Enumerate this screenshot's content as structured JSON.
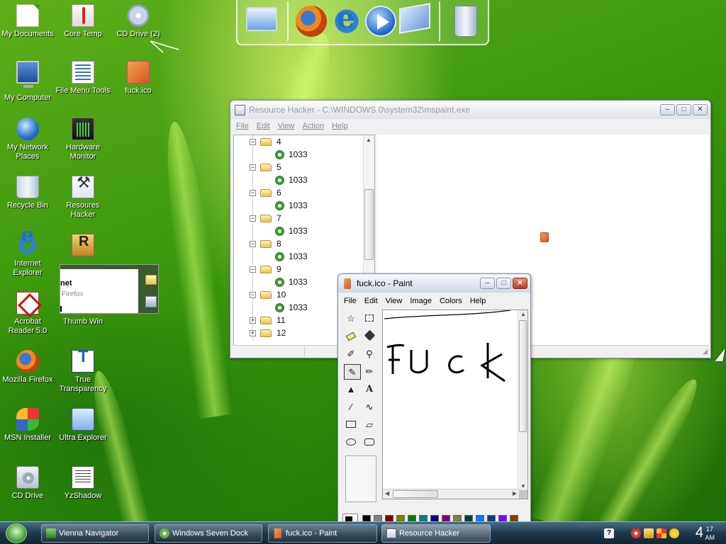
{
  "desktop": {
    "icons": {
      "my_documents": "My Documents",
      "core_temp": "Core Temp",
      "cd_drive_2": "CD Drive (2)",
      "my_computer": "My Computer",
      "file_menu_tools": "File Menu Tools",
      "fuck_ico": "fuck.ico",
      "my_network_places_1": "My Network",
      "my_network_places_2": "Places",
      "hardware_monitor_1": "Hardware",
      "hardware_monitor_2": "Monitor",
      "recycle_bin": "Recycle Bin",
      "resoures_hacker_1": "Resoures",
      "resoures_hacker_2": "Hacker",
      "internet_explorer_1": "Internet",
      "internet_explorer_2": "Explorer",
      "acrobat_1": "Acrobat",
      "acrobat_2": "Reader 5.0",
      "thumb_win": "Thumb Win",
      "mozilla_firefox": "Mozilla Firefox",
      "true_transparency_1": "True",
      "true_transparency_2": "Transparency",
      "msn_installer": "MSN Installer",
      "ultra_explorer": "Ultra Explorer",
      "cd_drive": "CD Drive",
      "yzshadow": "YzShadow"
    },
    "overlay": {
      "line1": "net",
      "line2": "Firefox"
    }
  },
  "dock": {
    "items": [
      "monitor-icon",
      "firefox-icon",
      "internet-explorer-icon",
      "media-player-icon",
      "windows-icon",
      "recycle-bin-icon"
    ]
  },
  "resource_hacker": {
    "title": "Resource Hacker   -  C:\\WINDOWS 0\\system32\\mspaint.exe",
    "menu": [
      "File",
      "Edit",
      "View",
      "Action",
      "Help"
    ],
    "tree": [
      {
        "label": "4",
        "type": "folder",
        "expanded": true
      },
      {
        "label": "1033",
        "type": "resource"
      },
      {
        "label": "5",
        "type": "folder",
        "expanded": true
      },
      {
        "label": "1033",
        "type": "resource"
      },
      {
        "label": "6",
        "type": "folder",
        "expanded": true
      },
      {
        "label": "1033",
        "type": "resource"
      },
      {
        "label": "7",
        "type": "folder",
        "expanded": true
      },
      {
        "label": "1033",
        "type": "resource"
      },
      {
        "label": "8",
        "type": "folder",
        "expanded": true
      },
      {
        "label": "1033",
        "type": "resource"
      },
      {
        "label": "9",
        "type": "folder",
        "expanded": true
      },
      {
        "label": "1033",
        "type": "resource"
      },
      {
        "label": "10",
        "type": "folder",
        "expanded": true
      },
      {
        "label": "1033",
        "type": "resource"
      },
      {
        "label": "11",
        "type": "folder",
        "expanded": false
      },
      {
        "label": "12",
        "type": "folder",
        "expanded": false
      }
    ]
  },
  "paint": {
    "title": "fuck.ico - Paint",
    "menu": [
      "File",
      "Edit",
      "View",
      "Image",
      "Colors",
      "Help"
    ],
    "tools": [
      "free-select",
      "rect-select",
      "eraser",
      "fill",
      "color-picker",
      "magnifier",
      "pencil",
      "brush",
      "airbrush",
      "text",
      "line",
      "curve",
      "rectangle",
      "polygon",
      "ellipse",
      "rounded-rectangle"
    ],
    "palette": [
      "#000000",
      "#808080",
      "#800000",
      "#808000",
      "#008000",
      "#008080",
      "#000080",
      "#800080",
      "#808040",
      "#004040",
      "#0080ff",
      "#004080",
      "#8000ff",
      "#804000"
    ]
  },
  "taskbar": {
    "tasks": [
      {
        "label": "Vienna Navigator"
      },
      {
        "label": "Windows Seven Dock"
      },
      {
        "label": "fuck.ico - Paint"
      },
      {
        "label": "Resource Hacker"
      }
    ],
    "clock": {
      "hour": "4",
      "minute": "17",
      "ampm": "AM"
    }
  },
  "colors": {
    "desktop_green": "#3f9a0e",
    "taskbar": "#1f3a4c",
    "close_button": "#c43a22"
  }
}
